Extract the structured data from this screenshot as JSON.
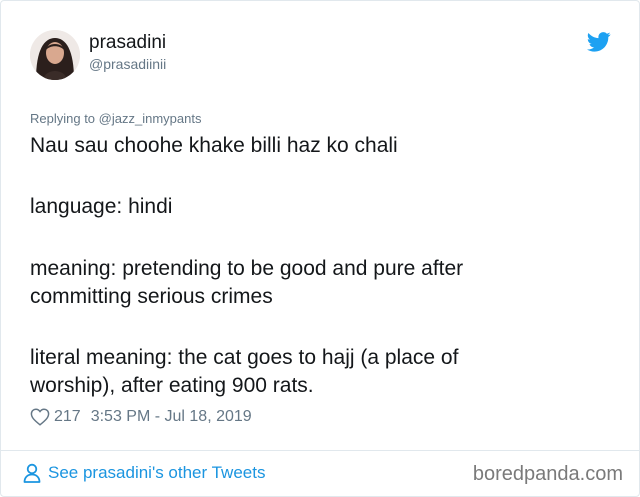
{
  "user": {
    "display_name": "prasadini",
    "handle": "@prasadiinii"
  },
  "reply": {
    "prefix": "Replying to ",
    "mention": "@jazz_inmypants"
  },
  "tweet": {
    "lines": [
      "Nau sau choohe khake billi haz ko chali",
      "language: hindi",
      "meaning: pretending to be good and pure after",
      "committing serious crimes",
      "literal meaning: the cat goes to hajj (a place of",
      "worship), after eating 900 rats."
    ]
  },
  "meta": {
    "likes": "217",
    "timestamp": "3:53 PM - Jul 18, 2019"
  },
  "footer": {
    "see_more": "See prasadini's other Tweets",
    "watermark": "boredpanda.com"
  },
  "icons": {
    "brand": "twitter-bird-icon",
    "like": "heart-outline-icon",
    "profile": "person-icon"
  },
  "colors": {
    "link": "#1b95e0",
    "brand": "#1da1f2",
    "muted": "#657786",
    "text": "#14171a"
  }
}
